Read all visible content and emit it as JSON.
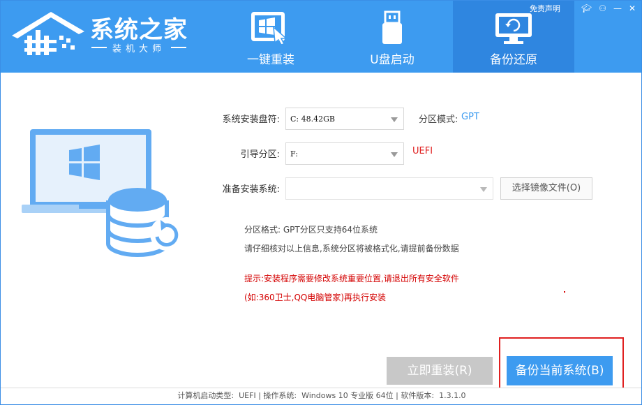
{
  "brand": {
    "title": "系统之家",
    "subtitle": "装机大师"
  },
  "top_links": {
    "notice": "免责声明"
  },
  "nav": [
    {
      "label": "一键重装",
      "icon": "windows-cursor-icon",
      "active": false
    },
    {
      "label": "U盘启动",
      "icon": "usb-drive-icon",
      "active": false
    },
    {
      "label": "备份还原",
      "icon": "monitor-restore-icon",
      "active": true
    }
  ],
  "form": {
    "disk_label": "系统安装盘符:",
    "disk_value": "C: 48.42GB",
    "partition_mode_label": "分区模式:",
    "partition_mode_value": "GPT",
    "boot_label": "引导分区:",
    "boot_value": "F:",
    "boot_mode_value": "UEFI",
    "system_label": "准备安装系统:",
    "system_value": "",
    "choose_image_button": "选择镜像文件(O)"
  },
  "messages": {
    "format_line": "分区格式:  GPT分区只支持64位系统",
    "verify_line": "请仔细核对以上信息,系统分区将被格式化,请提前备份数据",
    "warn_line1": "提示:安装程序需要修改系统重要位置,请退出所有安全软件",
    "warn_line2": "(如:360卫士,QQ电脑管家)再执行安装"
  },
  "buttons": {
    "reinstall": "立即重装(R)",
    "backup": "备份当前系统(B)"
  },
  "footer": {
    "text": "计算机启动类型:  UEFI | 操作系统:  Windows 10 专业版 64位 | 软件版本:  1.3.1.0"
  },
  "colors": {
    "primary": "#3d9bf0",
    "active_tab": "#2f86e0",
    "warning": "#d40000",
    "highlight": "#e02020"
  }
}
